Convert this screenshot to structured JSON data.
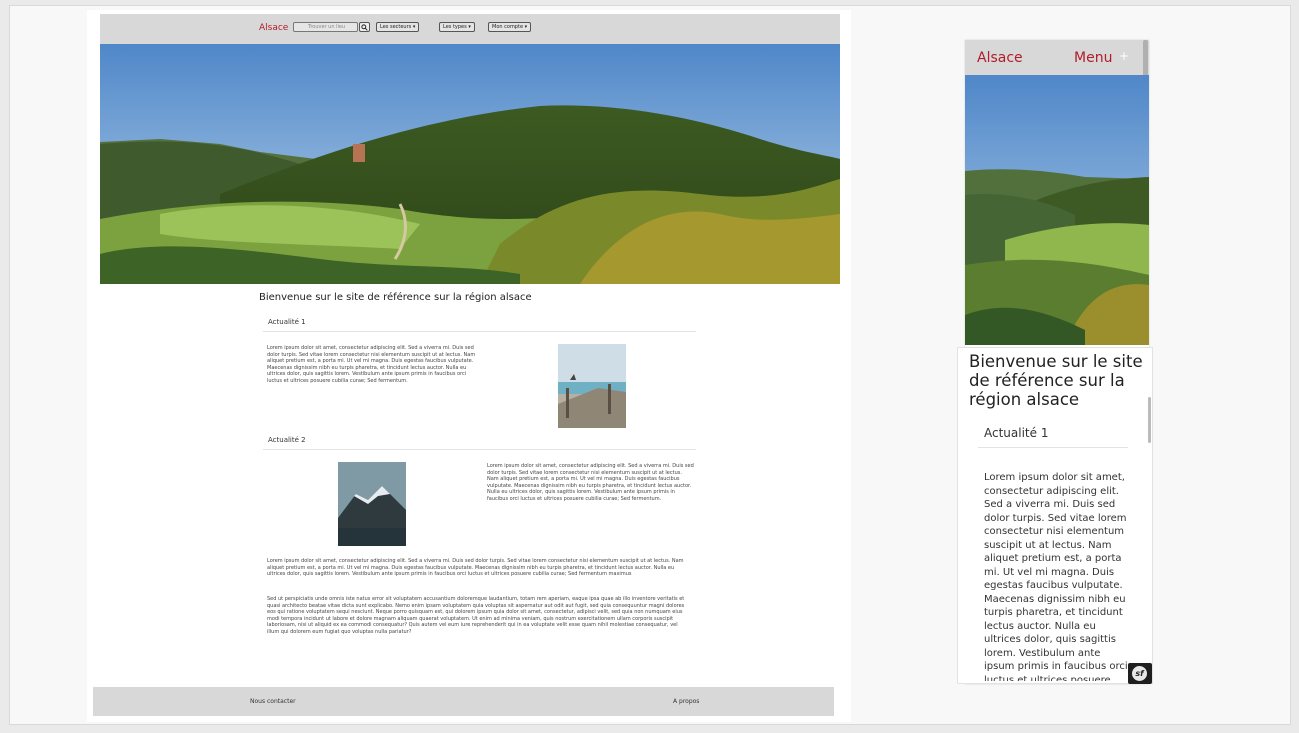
{
  "desktop": {
    "nav": {
      "brand": "Alsace",
      "search_placeholder": "Trouver un lieu",
      "search_button_icon": "search-icon",
      "dropdowns": [
        "Les secteurs",
        "Les types",
        "Mon compte"
      ]
    },
    "welcome": "Bienvenue sur le site de référence sur la région alsace",
    "news": [
      {
        "heading": "Actualité 1",
        "text": "Lorem ipsum dolor sit amet, consectetur adipiscing elit. Sed a viverra mi. Duis sed dolor turpis. Sed vitae lorem consectetur nisi elementum suscipit ut at lectus. Nam aliquet pretium est, a porta mi. Ut vel mi magna. Duis egestas faucibus vulputate. Maecenas dignissim nibh eu turpis pharetra, et tincidunt lectus auctor. Nulla eu ultrices dolor, quis sagittis lorem. Vestibulum ante ipsum primis in faucibus orci luctus et ultrices posuere cubilia curae; Sed fermentum."
      },
      {
        "heading": "Actualité 2",
        "text": "Lorem ipsum dolor sit amet, consectetur adipiscing elit. Sed a viverra mi. Duis sed dolor turpis. Sed vitae lorem consectetur nisi elementum suscipit ut at lectus. Nam aliquet pretium est, a porta mi. Ut vel mi magna. Duis egestas faucibus vulputate. Maecenas dignissim nibh eu turpis pharetra, et tincidunt lectus auctor. Nulla eu ultrices dolor, quis sagittis lorem. Vestibulum ante ipsum primis in faucibus orci luctus et ultrices posuere cubilia curae; Sed fermentum."
      }
    ],
    "para1": "Lorem ipsum dolor sit amet, consectetur adipiscing elit. Sed a viverra mi. Duis sed dolor turpis. Sed vitae lorem consectetur nisi elementum suscipit ut at lectus. Nam aliquet pretium est, a porta mi. Ut vel mi magna. Duis egestas faucibus vulputate. Maecenas dignissim nibh eu turpis pharetra, et tincidunt lectus auctor. Nulla eu ultrices dolor, quis sagittis lorem. Vestibulum ante ipsum primis in faucibus orci luctus et ultrices posuere cubilia curae; Sed fermentum maximus",
    "para2": "Sed ut perspiciatis unde omnis iste natus error sit voluptatem accusantium doloremque laudantium, totam rem aperiam, eaque ipsa quae ab illo inventore veritatis et quasi architecto beatae vitae dicta sunt explicabo. Nemo enim ipsam voluptatem quia voluptas sit aspernatur aut odit aut fugit, sed quia consequuntur magni dolores eos qui ratione voluptatem sequi nesciunt. Neque porro quisquam est, qui dolorem ipsum quia dolor sit amet, consectetur, adipisci velit, sed quia non numquam eius modi tempora incidunt ut labore et dolore magnam aliquam quaerat voluptatem. Ut enim ad minima veniam, quis nostrum exercitationem ullam corporis suscipit laboriosam, nisi ut aliquid ex ea commodi consequatur? Quis autem vel eum iure reprehenderit qui in ea voluptate velit esse quam nihil molestiae consequatur, vel illum qui dolorem eum fugiat quo voluptas nulla pariatur?",
    "footer": {
      "contact": "Nous contacter",
      "about": "A propos"
    }
  },
  "mobile": {
    "brand": "Alsace",
    "menu": "Menu",
    "menu_icon": "+",
    "welcome": "Bienvenue sur le site de référence sur la région alsace",
    "news_heading": "Actualité 1",
    "news_text": "Lorem ipsum dolor sit amet, consectetur adipiscing elit. Sed a viverra mi. Duis sed dolor turpis. Sed vitae lorem consectetur nisi elementum suscipit ut at lectus. Nam aliquet pretium est, a porta mi. Ut vel mi magna. Duis egestas faucibus vulputate. Maecenas dignissim nibh eu turpis pharetra, et tincidunt lectus auctor. Nulla eu ultrices dolor, quis sagittis lorem. Vestibulum ante ipsum primis in faucibus orci luctus et ultrices posuere cubilia curae;"
  },
  "colors": {
    "brand_red": "#b11d2a",
    "nav_gray": "#d8d8d8"
  }
}
